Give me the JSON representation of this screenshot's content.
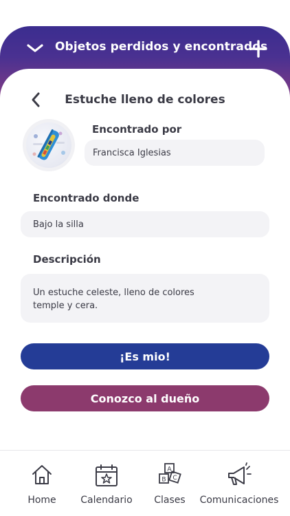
{
  "header": {
    "title": "Objetos perdidos y encontrados",
    "collapse_icon": "chevron-down-icon",
    "add_icon": "plus-icon"
  },
  "item": {
    "title": "Estuche lleno de colores",
    "back_icon": "chevron-left-icon",
    "found_by_label": "Encontrado por",
    "found_by_value": "Francisca Iglesias",
    "found_where_label": "Encontrado donde",
    "found_where_value": "Bajo la silla",
    "description_label": "Descripción",
    "description_value": "Un estuche celeste, lleno de colores\ntemple y cera."
  },
  "actions": {
    "mine_label": "¡Es mio!",
    "know_owner_label": "Conozco al dueño"
  },
  "tabbar": {
    "items": [
      {
        "label": "Home",
        "icon": "home-icon"
      },
      {
        "label": "Calendario",
        "icon": "calendar-icon"
      },
      {
        "label": "Clases",
        "icon": "abc-blocks-icon"
      },
      {
        "label": "Comunicaciones",
        "icon": "megaphone-icon"
      }
    ]
  },
  "colors": {
    "header_gradient_top": "#3b2d8f",
    "header_gradient_bottom": "#8e3d7e",
    "primary_button": "#243c96",
    "secondary_button": "#8c3a6d",
    "field_background": "#f3f3f6"
  }
}
